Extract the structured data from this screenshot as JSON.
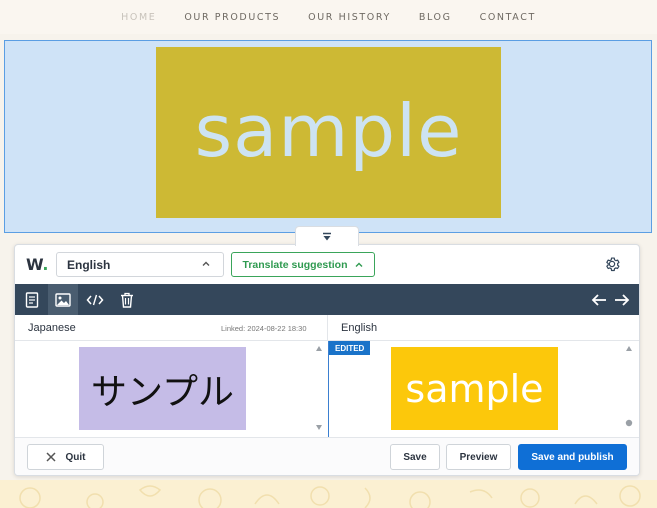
{
  "site_nav": {
    "items": [
      "HOME",
      "OUR PRODUCTS",
      "OUR HISTORY",
      "BLOG",
      "CONTACT"
    ]
  },
  "hero": {
    "image_text": "sample",
    "image_color": "#cdb934",
    "selection_color": "#cfe3f7"
  },
  "editor": {
    "logo": "W",
    "logo_dot": ".",
    "language_selected": "English",
    "translate_suggestion_label": "Translate suggestion",
    "toolbar_icons": [
      "document-icon",
      "image-icon",
      "code-icon",
      "trash-icon",
      "arrow-left-icon",
      "arrow-right-icon"
    ],
    "source_label": "Japanese",
    "linked_text": "Linked: 2024-08-22 18:30",
    "target_label": "English",
    "edited_badge": "EDITED",
    "source_image_text": "サンプル",
    "source_image_color": "#c5bce7",
    "target_image_text": "sample",
    "target_image_color": "#fcc80b",
    "quit_label": "Quit",
    "save_label": "Save",
    "preview_label": "Preview",
    "save_publish_label": "Save and publish",
    "accent_green": "#3aa55a",
    "accent_blue": "#0f6fd6",
    "toolbar_color": "#34475b"
  }
}
